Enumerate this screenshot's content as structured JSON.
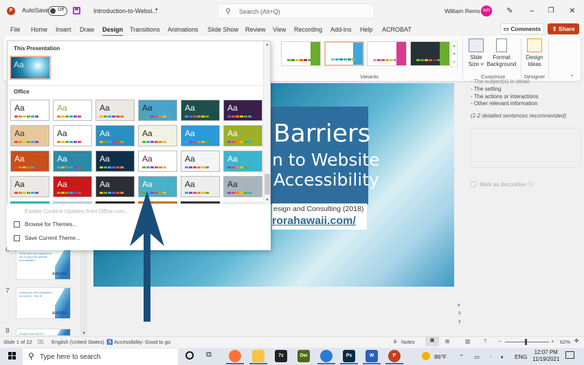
{
  "titlebar": {
    "autosave_label": "AutoSave",
    "autosave_state": "Off",
    "document_name": "Introduction-to-Websi...",
    "search_placeholder": "Search (Alt+Q)",
    "user_name": "William Rems",
    "user_initials": "WR",
    "minimize": "−",
    "restore": "❐",
    "close": "✕"
  },
  "menu": {
    "items": [
      "File",
      "Home",
      "Insert",
      "Draw",
      "Design",
      "Transitions",
      "Animations",
      "Slide Show",
      "Review",
      "View",
      "Recording",
      "Add-ins",
      "Help",
      "ACROBAT"
    ],
    "active": "Design",
    "comments_label": "Comments",
    "share_label": "Share"
  },
  "ribbon": {
    "variants_label": "Variants",
    "customize_label": "Customize",
    "designer_label": "Designer",
    "slide_size_label_1": "Slide",
    "slide_size_label_2": "Size ˅",
    "format_bg_label_1": "Format",
    "format_bg_label_2": "Background",
    "design_ideas_label_1": "Design",
    "design_ideas_label_2": "Ideas",
    "variants": [
      {
        "accent": "#6aac2c",
        "bg": "#ffffff",
        "selected": false
      },
      {
        "accent": "#3fa7dc",
        "bg": "#ffffff",
        "selected": true
      },
      {
        "accent": "#d93a8e",
        "bg": "#ffffff",
        "selected": false
      },
      {
        "accent": "#6aac2c",
        "bg": "#263238",
        "selected": false
      }
    ]
  },
  "gallery": {
    "section_this": "This Presentation",
    "section_office": "Office",
    "menu": {
      "enable_updates": "Enable Content Updates from Office.com...",
      "browse_themes": "Browse for Themes...",
      "save_theme": "Save Current Theme..."
    },
    "themes": [
      {
        "bg": "#ffffff",
        "fg": "#222222"
      },
      {
        "bg": "#ffffff",
        "fg": "#7ab42c"
      },
      {
        "bg": "#ece8e2",
        "fg": "#222222"
      },
      {
        "bg": "#4aa3c8",
        "fg": "#222222"
      },
      {
        "bg": "#1f4f4a",
        "fg": "#ffffff"
      },
      {
        "bg": "#3a1f4a",
        "fg": "#ffffff"
      },
      {
        "bg": "#e8c89a",
        "fg": "#333333"
      },
      {
        "bg": "#ffffff",
        "fg": "#222222"
      },
      {
        "bg": "#2a8fc0",
        "fg": "#ffffff"
      },
      {
        "bg": "#f2f2e4",
        "fg": "#222222"
      },
      {
        "bg": "#2a9ad8",
        "fg": "#ffffff"
      },
      {
        "bg": "#9cb02a",
        "fg": "#ffffff"
      },
      {
        "bg": "#c8501a",
        "fg": "#ffffff"
      },
      {
        "bg": "#2a8aa8",
        "fg": "#ffffff"
      },
      {
        "bg": "#10304a",
        "fg": "#ffffff"
      },
      {
        "bg": "#ffffff",
        "fg": "#5a1a3a"
      },
      {
        "bg": "#f5f5f5",
        "fg": "#222222"
      },
      {
        "bg": "#3ab5d0",
        "fg": "#ffffff"
      },
      {
        "bg": "#ece8e4",
        "fg": "#222222"
      },
      {
        "bg": "#c81a1a",
        "fg": "#ffffff"
      },
      {
        "bg": "#2a2f36",
        "fg": "#ffffff"
      },
      {
        "bg": "#4ab0c8",
        "fg": "#ffffff"
      },
      {
        "bg": "#eeeeee",
        "fg": "#222222"
      },
      {
        "bg": "#a8b4bc",
        "fg": "#222222"
      }
    ],
    "theme_label": "Aa"
  },
  "right_pane": {
    "lines": [
      "- The subject(s) in detail",
      "- The setting",
      "- The actions or interactions",
      "- Other relevant information"
    ],
    "note": "(1-2 detailed sentences recommended)",
    "decorative_label": "Mark as decorative"
  },
  "slide": {
    "title": "Barriers",
    "subtitle_1": "n to Website",
    "subtitle_2": "Accessibility",
    "credit": "esign and Consulting (2018)",
    "url": "rorahawaii.com/"
  },
  "thumbnails": [
    {
      "num": "6",
      "title": "What laws and regulations are in place for website accessibility?",
      "logo": "AURORA"
    },
    {
      "num": "7",
      "title": "Americans with Disabilities Act (ADA) - Title III",
      "logo": "AURORA"
    },
    {
      "num": "8",
      "title": "Section 508 and ICT Refresh",
      "logo": ""
    }
  ],
  "statusbar": {
    "slide_info": "Slide 1 of 22",
    "language": "English (United States)",
    "accessibility": "Accessibility: Good to go",
    "notes_label": "Notes",
    "zoom_minus": "−",
    "zoom_plus": "+",
    "zoom_level": "62%",
    "zoom_fraction": 0.45
  },
  "taskbar": {
    "search_placeholder": "Type here to search",
    "weather": "86°F",
    "language": "ENG",
    "time": "12:07 PM",
    "date": "11/19/2021",
    "apps": [
      {
        "name": "firefox",
        "label": "",
        "color": "#ff7139"
      },
      {
        "name": "file-explorer",
        "label": "",
        "color": "#f5c542"
      },
      {
        "name": "7zip",
        "label": "7z",
        "color": "#222222"
      },
      {
        "name": "dreamweaver",
        "label": "Dw",
        "color": "#4c6b10"
      },
      {
        "name": "thunderbird",
        "label": "",
        "color": "#2a7bd5"
      },
      {
        "name": "photoshop",
        "label": "Ps",
        "color": "#0a2a4a"
      },
      {
        "name": "word",
        "label": "W",
        "color": "#2b5fb8"
      },
      {
        "name": "powerpoint",
        "label": "P",
        "color": "#c43e1c"
      }
    ]
  }
}
